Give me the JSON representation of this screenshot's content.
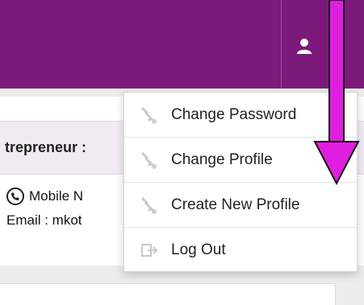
{
  "header": {
    "user_icon": "user-icon"
  },
  "profile": {
    "entrepreneur_label": "trepreneur :",
    "mobile_label": "Mobile N",
    "email_label": "Email : mkot"
  },
  "dropdown": {
    "items": [
      {
        "label": "Change Password",
        "icon": "key-icon"
      },
      {
        "label": "Change Profile",
        "icon": "key-icon"
      },
      {
        "label": "Create New Profile",
        "icon": "key-icon"
      },
      {
        "label": "Log Out",
        "icon": "logout-icon"
      }
    ]
  },
  "colors": {
    "topbar": "#7b1a7b",
    "arrow": "#e01ee0",
    "icon_grey": "#c8c8c8"
  }
}
